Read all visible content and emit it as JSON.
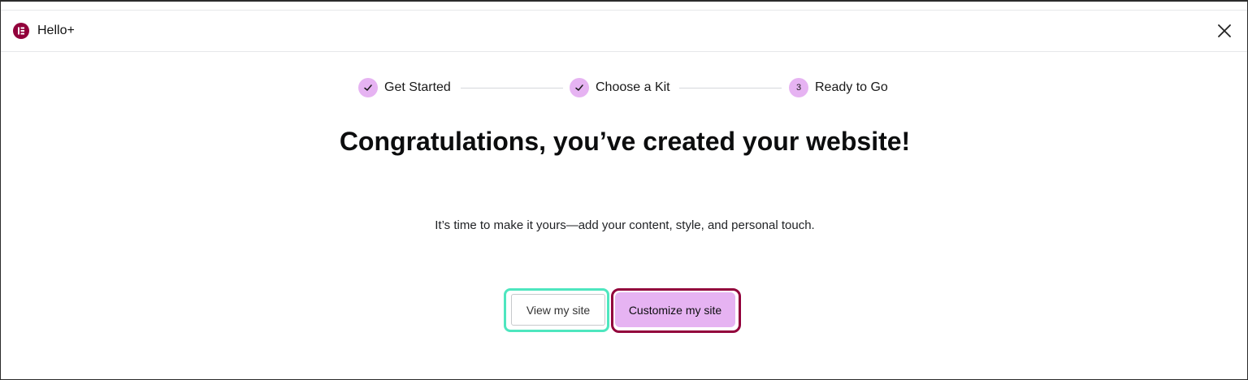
{
  "header": {
    "app_title": "Hello+",
    "logo_icon": "elementor-logo-icon",
    "close_icon": "close-icon"
  },
  "stepper": {
    "steps": [
      {
        "label": "Get Started",
        "status": "completed",
        "marker": "check-icon"
      },
      {
        "label": "Choose a Kit",
        "status": "completed",
        "marker": "check-icon"
      },
      {
        "label": "Ready to Go",
        "status": "current",
        "marker": "3"
      }
    ]
  },
  "main": {
    "headline": "Congratulations, you’ve created your website!",
    "subtitle": "It’s time to make it yours—add your content, style, and personal touch."
  },
  "actions": {
    "view_label": "View my site",
    "customize_label": "Customize my site"
  },
  "colors": {
    "brand": "#92003b",
    "step_accent": "#e6b3f2",
    "view_highlight": "#4ee6bf",
    "customize_highlight": "#92003b"
  }
}
